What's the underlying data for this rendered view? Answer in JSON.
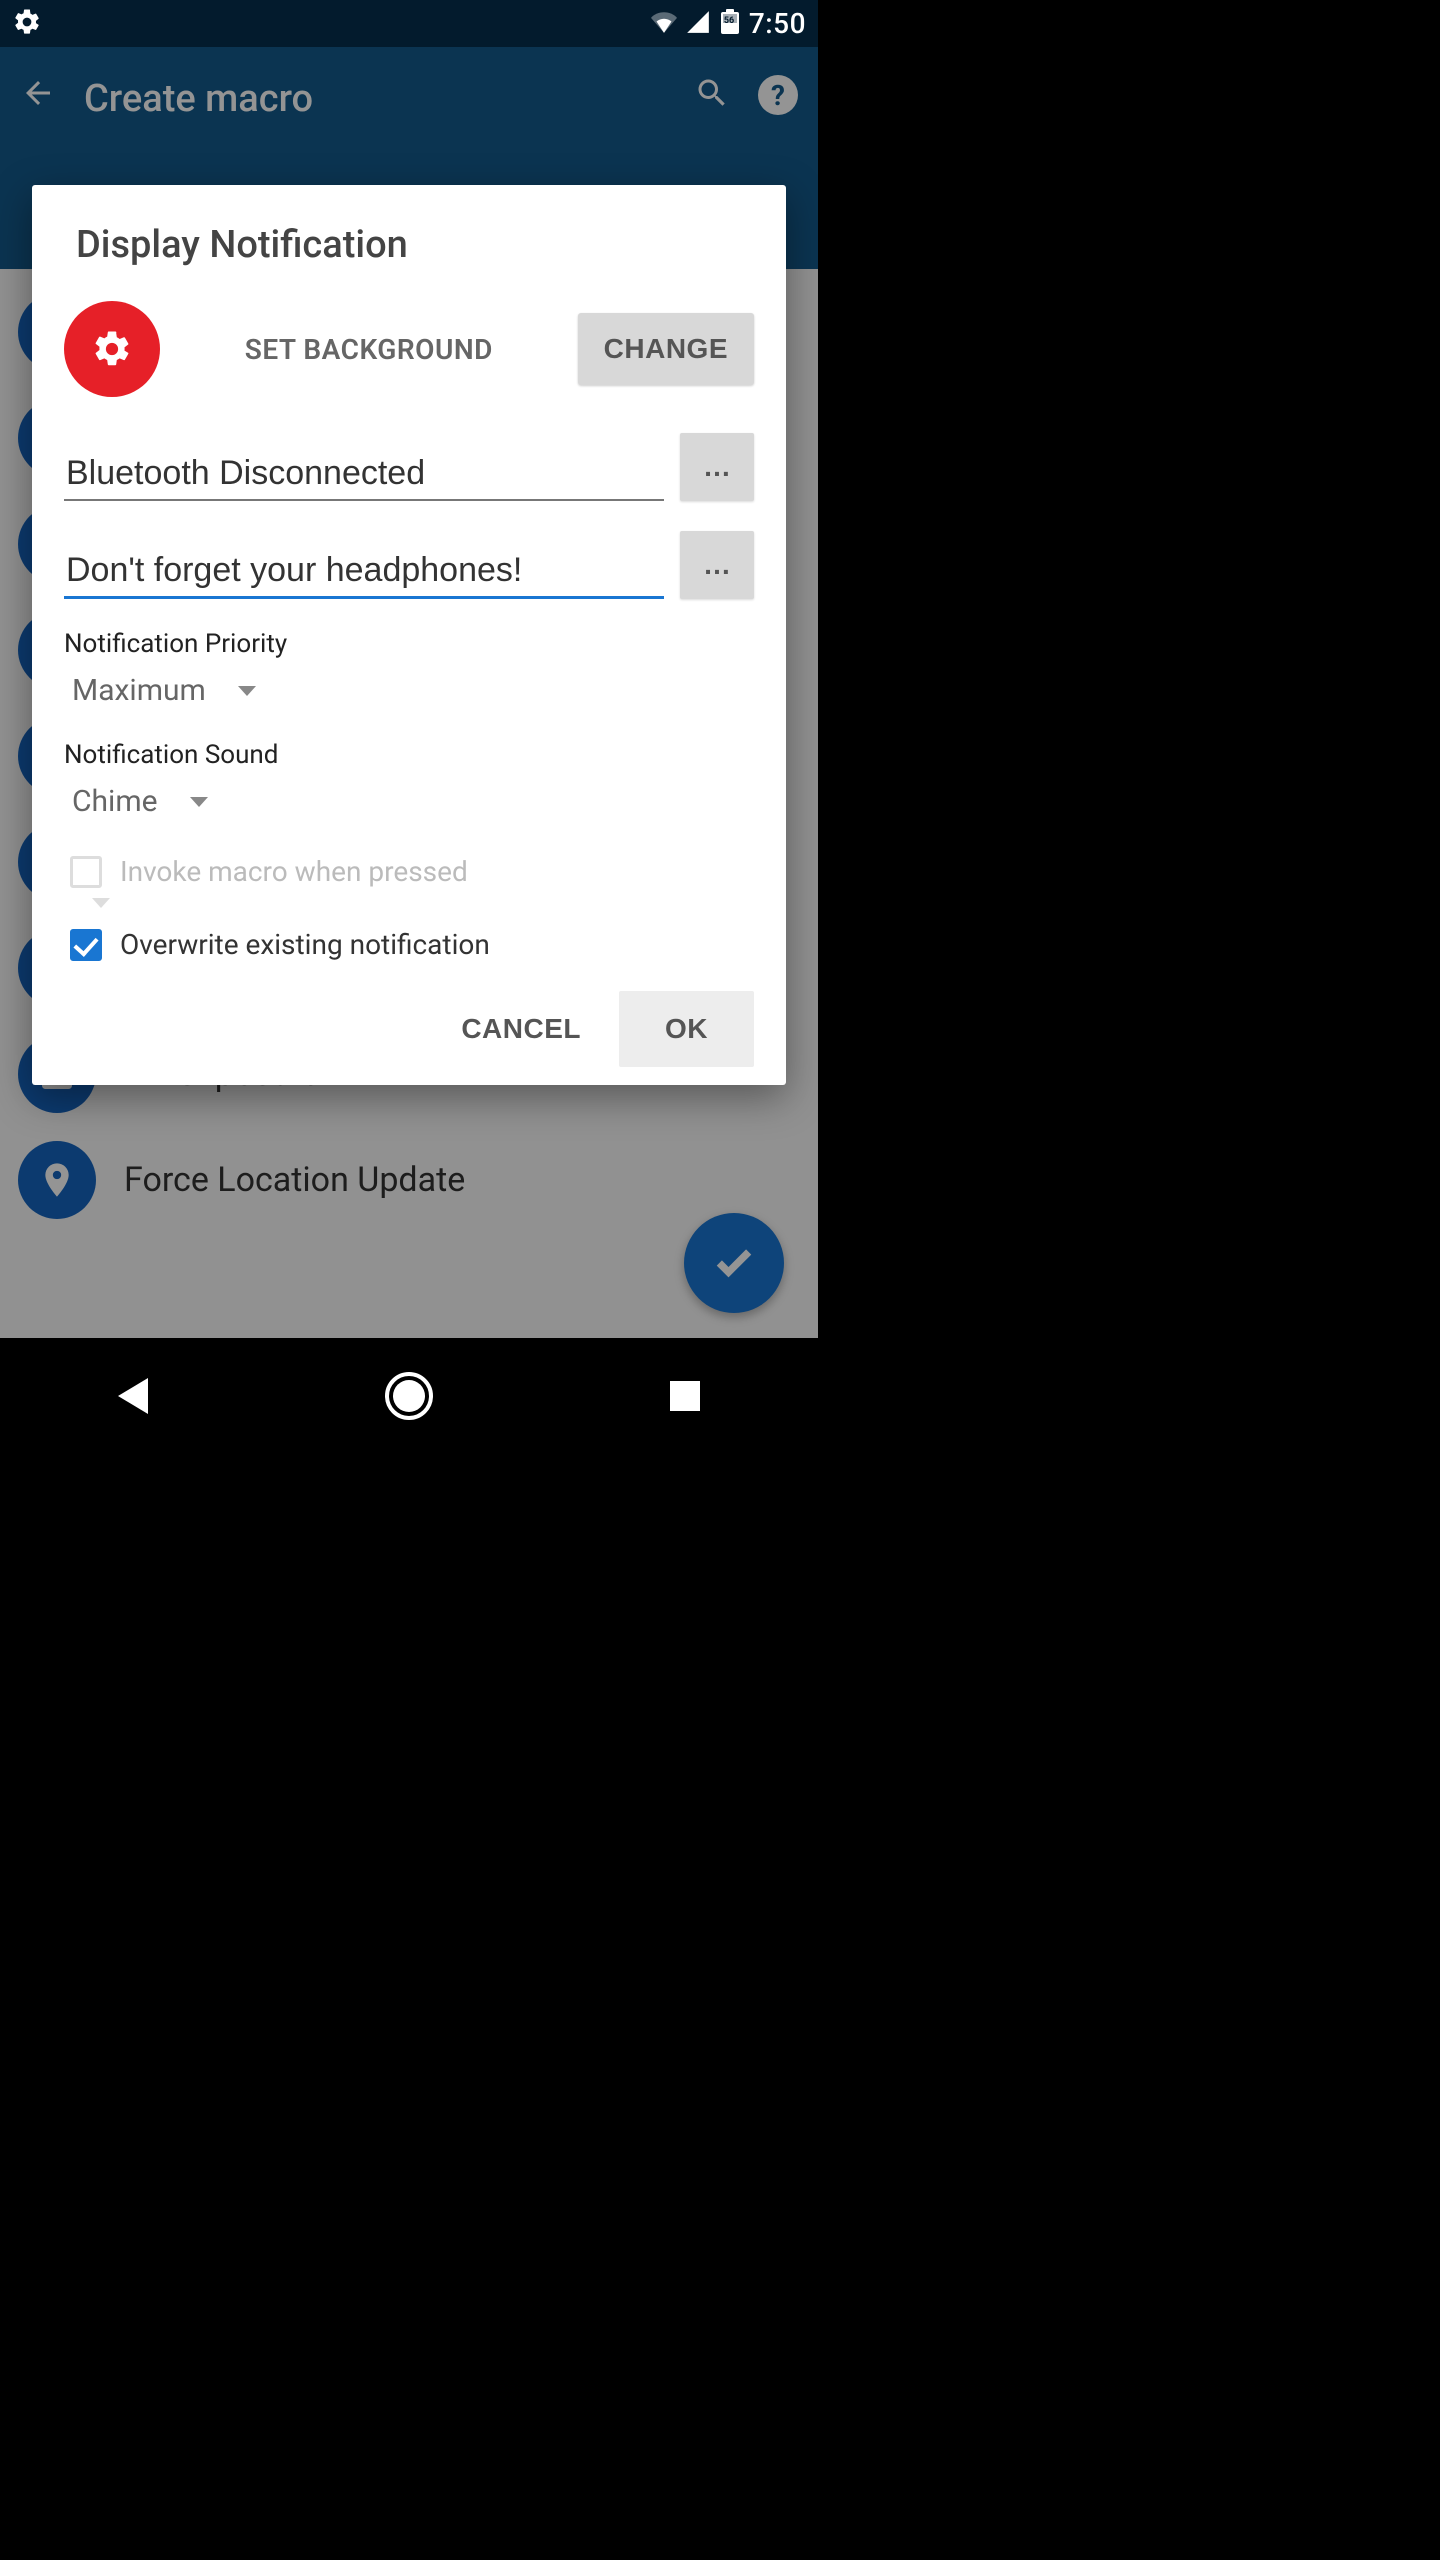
{
  "status": {
    "time": "7:50",
    "battery_label": "56"
  },
  "appbar": {
    "title": "Create macro"
  },
  "bg_items": [
    {
      "label": ""
    },
    {
      "label": ""
    },
    {
      "label": ""
    },
    {
      "label": ""
    },
    {
      "label": ""
    },
    {
      "label": ""
    },
    {
      "label": ""
    },
    {
      "label": "Fill Clipboard"
    },
    {
      "label": "Force Location Update"
    }
  ],
  "dialog": {
    "title": "Display Notification",
    "set_background_label": "SET BACKGROUND",
    "change_button": "CHANGE",
    "field_title": "Bluetooth Disconnected",
    "field_body": "Don't forget your headphones!",
    "dots": "…",
    "priority_label": "Notification Priority",
    "priority_value": "Maximum",
    "sound_label": "Notification Sound",
    "sound_value": "Chime",
    "invoke_label": "Invoke macro when pressed",
    "invoke_checked": false,
    "overwrite_label": "Overwrite existing notification",
    "overwrite_checked": true,
    "cancel": "CANCEL",
    "ok": "OK"
  }
}
